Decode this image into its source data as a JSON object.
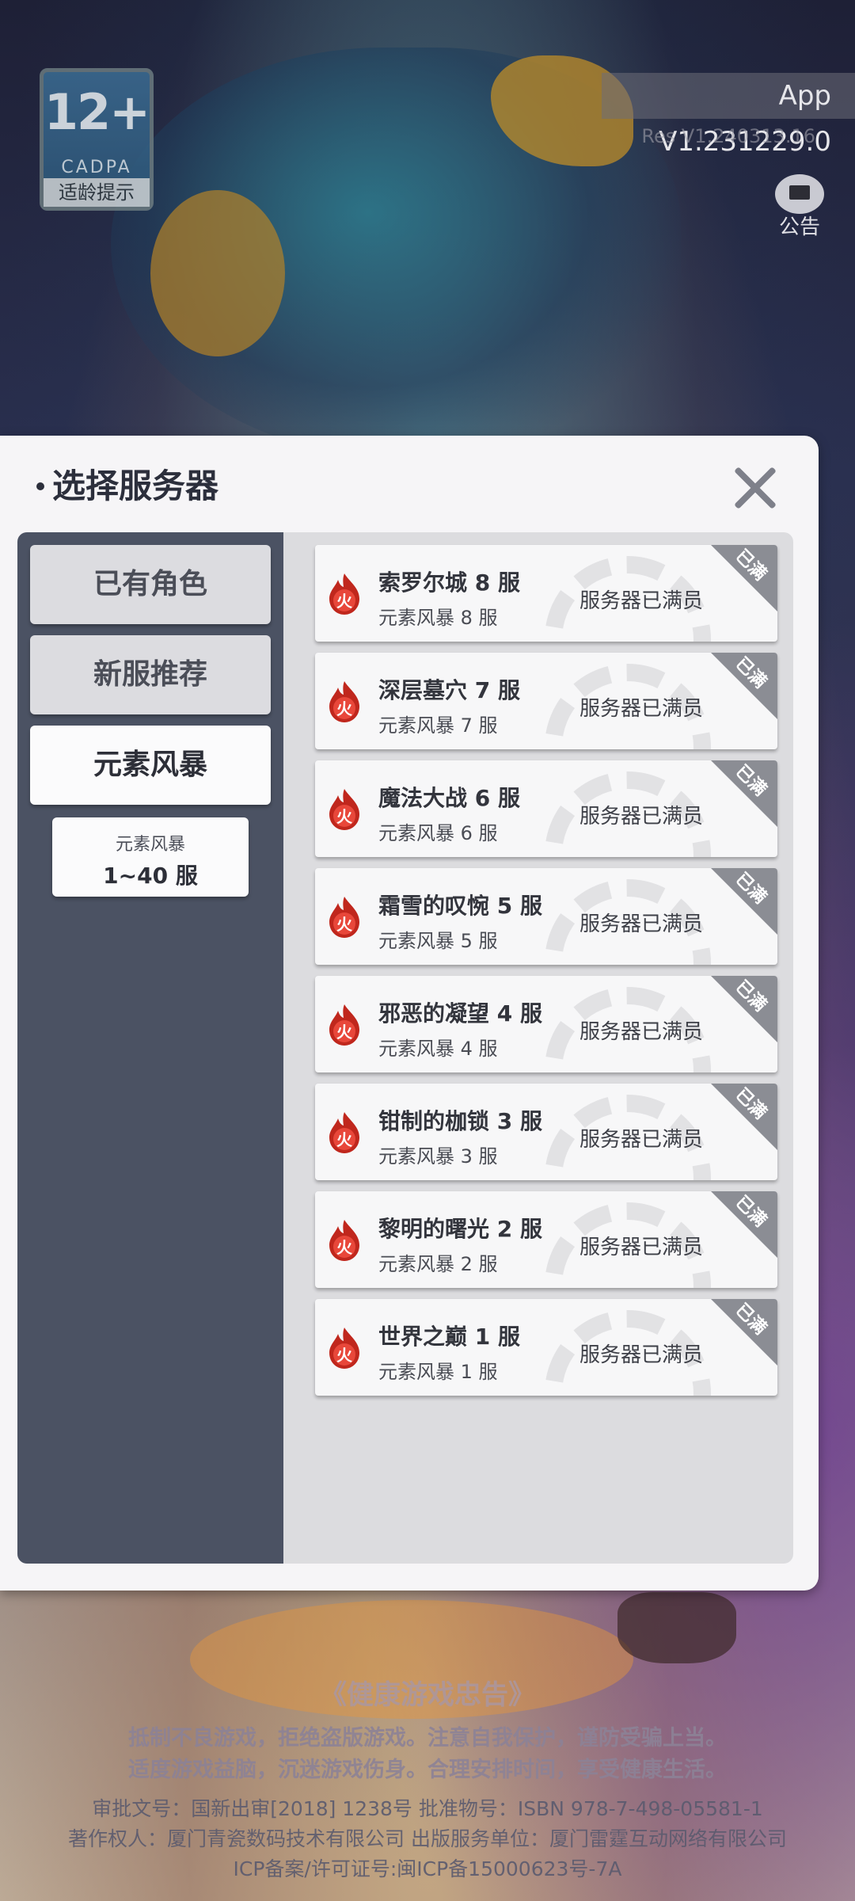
{
  "overlay": {
    "age_rating": "12+",
    "age_org": "CADPA",
    "age_tip": "适龄提示",
    "app_version": "App V1.231229.0",
    "res_version": "Res V1.240313.16",
    "notice_label": "公告"
  },
  "dialog": {
    "title": "选择服务器",
    "sidebar": {
      "tabs": [
        {
          "label": "已有角色"
        },
        {
          "label": "新服推荐"
        },
        {
          "label": "元素风暴"
        }
      ],
      "subtab": {
        "top": "元素风暴",
        "bottom": "1~40 服"
      }
    },
    "servers": [
      {
        "name": "索罗尔城 8 服",
        "group": "元素风暴 8 服",
        "status": "服务器已满员",
        "badge": "已满"
      },
      {
        "name": "深层墓穴 7 服",
        "group": "元素风暴 7 服",
        "status": "服务器已满员",
        "badge": "已满"
      },
      {
        "name": "魔法大战 6 服",
        "group": "元素风暴 6 服",
        "status": "服务器已满员",
        "badge": "已满"
      },
      {
        "name": "霜雪的叹惋 5 服",
        "group": "元素风暴 5 服",
        "status": "服务器已满员",
        "badge": "已满"
      },
      {
        "name": "邪恶的凝望 4 服",
        "group": "元素风暴 4 服",
        "status": "服务器已满员",
        "badge": "已满"
      },
      {
        "name": "钳制的枷锁 3 服",
        "group": "元素风暴 3 服",
        "status": "服务器已满员",
        "badge": "已满"
      },
      {
        "name": "黎明的曙光 2 服",
        "group": "元素风暴 2 服",
        "status": "服务器已满员",
        "badge": "已满"
      },
      {
        "name": "世界之巅 1 服",
        "group": "元素风暴 1 服",
        "status": "服务器已满员",
        "badge": "已满"
      }
    ],
    "fire_glyph": "火"
  },
  "footer": {
    "heading": "《健康游戏忠告》",
    "advice_1": "抵制不良游戏，拒绝盗版游戏。注意自我保护，谨防受骗上当。",
    "advice_2": "适度游戏益脑，沉迷游戏伤身。合理安排时间，享受健康生活。",
    "legal_1": "审批文号：国新出审[2018] 1238号 批准物号：ISBN 978-7-498-05581-1",
    "legal_2": "著作权人：厦门青瓷数码技术有限公司 出版服务单位：厦门雷霆互动网络有限公司",
    "legal_3": "ICP备案/许可证号:闽ICP备15000623号-7A"
  },
  "colors": {
    "sidebar_bg": "#4b5263",
    "panel_bg": "#dcdcdf",
    "card_bg": "#f7f7f8",
    "badge_bg": "#8b8d94",
    "fire_red": "#d83a2e"
  }
}
